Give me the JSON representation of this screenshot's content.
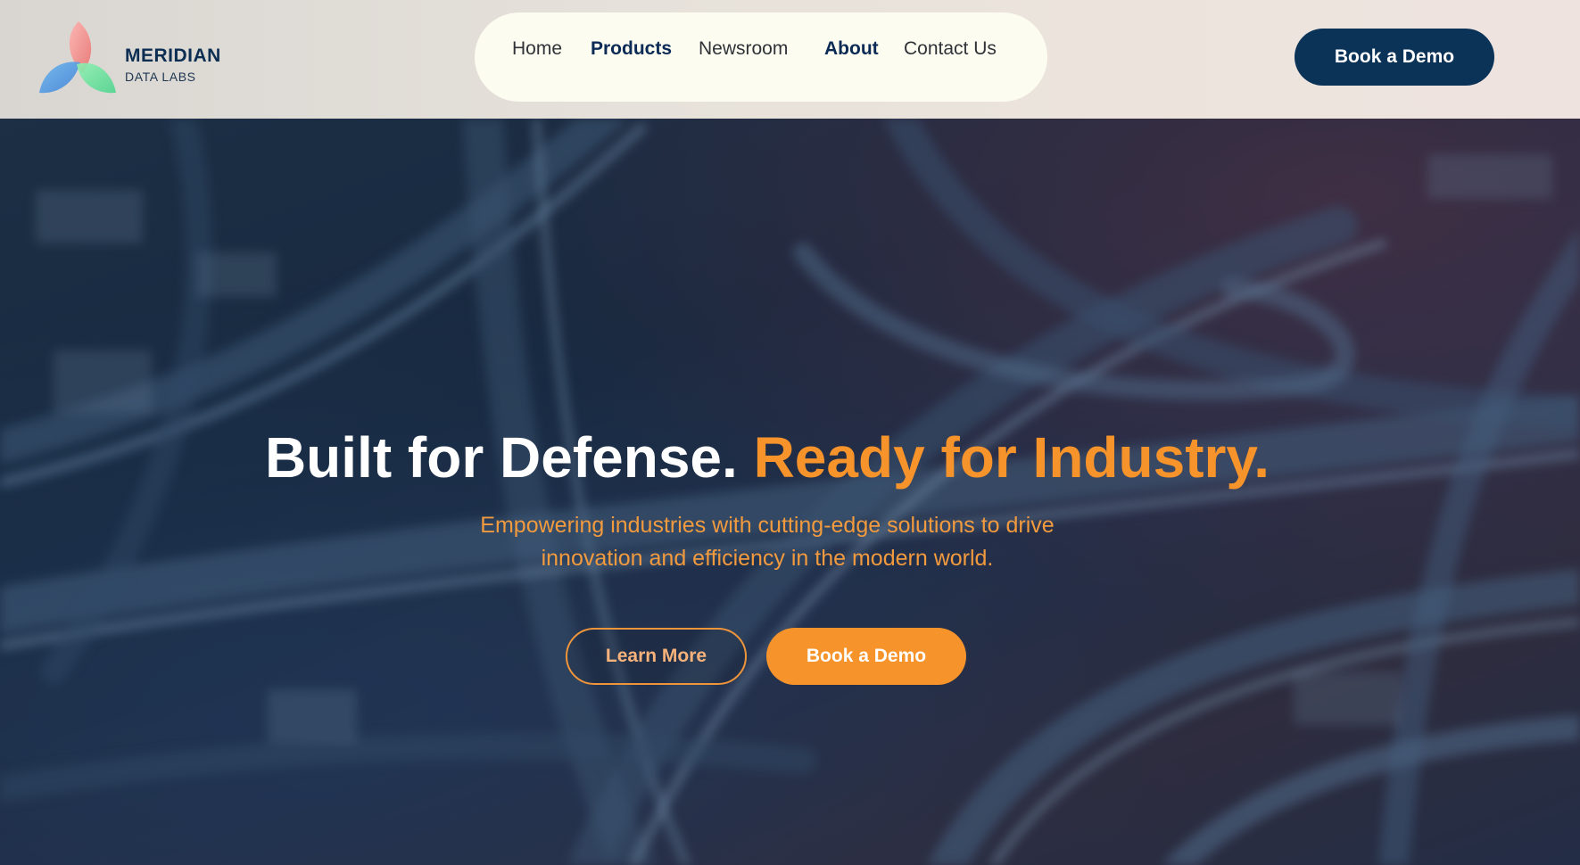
{
  "brand": {
    "name": "MERIDIAN",
    "tagline": "DATA LABS"
  },
  "nav": {
    "items": [
      {
        "label": "Home",
        "active": false
      },
      {
        "label": "Products",
        "active": true
      },
      {
        "label": "Newsroom",
        "active": false
      },
      {
        "label": "About",
        "active": true
      },
      {
        "label": "Contact Us",
        "active": false
      }
    ]
  },
  "header": {
    "cta_label": "Book a Demo"
  },
  "hero": {
    "title_part1": "Built for Defense.",
    "title_part2": "Ready for Industry.",
    "subtitle_line1": "Empowering industries with cutting-edge solutions to drive",
    "subtitle_line2": "innovation and efficiency in the modern world.",
    "primary_button": "Learn More",
    "secondary_button": "Book a Demo"
  },
  "colors": {
    "navy": "#0b3358",
    "orange": "#f7932b",
    "nav_pill": "#fdfcf0"
  },
  "icons": {
    "logo": "tri-petal-logo-icon"
  }
}
